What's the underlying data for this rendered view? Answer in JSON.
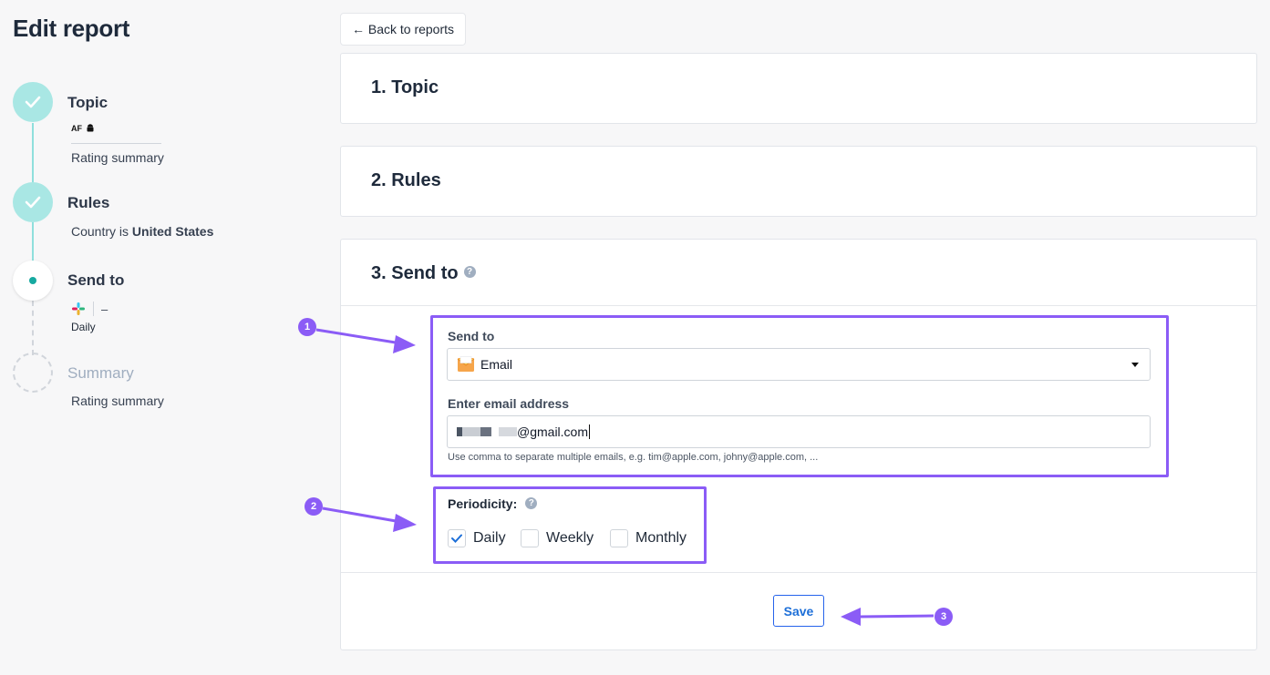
{
  "page": {
    "title": "Edit report"
  },
  "stepper": {
    "topic": {
      "title": "Topic",
      "badge_text": "AF",
      "platform_icon": "android-icon",
      "subtitle": "Rating summary"
    },
    "rules": {
      "title": "Rules",
      "subtitle_prefix": "Country is ",
      "subtitle_value": "United States"
    },
    "send_to": {
      "title": "Send to",
      "channel_icon": "slack-icon",
      "dash": "–",
      "frequency": "Daily"
    },
    "summary": {
      "title": "Summary",
      "subtitle": "Rating summary"
    }
  },
  "back_button": {
    "label": "← Back to reports"
  },
  "sections": {
    "topic": {
      "title": "1. Topic"
    },
    "rules": {
      "title": "2. Rules"
    },
    "send_to": {
      "title": "3. Send to",
      "help_icon": "?",
      "send_to_label": "Send to",
      "send_to_value": "Email",
      "email_label": "Enter email address",
      "email_value": "@gmail.com",
      "email_hint": "Use comma to separate multiple emails, e.g. tim@apple.com, johny@apple.com, ...",
      "periodicity_label": "Periodicity:",
      "options": [
        {
          "label": "Daily",
          "checked": true
        },
        {
          "label": "Weekly",
          "checked": false
        },
        {
          "label": "Monthly",
          "checked": false
        }
      ],
      "save_label": "Save"
    }
  },
  "annotations": {
    "one": "1",
    "two": "2",
    "three": "3"
  },
  "colors": {
    "accent": "#8b5cf6",
    "teal": "#a9e7e4",
    "primary": "#2563eb"
  }
}
